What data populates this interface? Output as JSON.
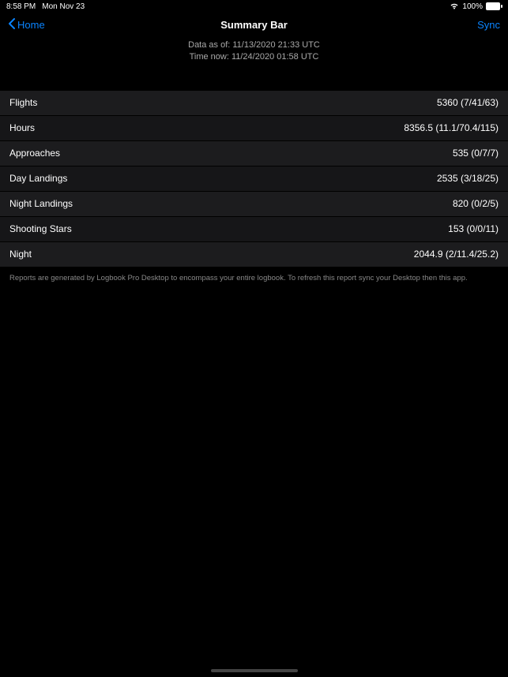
{
  "status": {
    "time": "8:58 PM",
    "date": "Mon Nov 23",
    "battery_pct": "100%"
  },
  "nav": {
    "back_label": "Home",
    "title": "Summary Bar",
    "sync_label": "Sync"
  },
  "header": {
    "data_as_of": "Data as of: 11/13/2020 21:33 UTC",
    "time_now": "Time now: 11/24/2020 01:58 UTC"
  },
  "rows": [
    {
      "label": "Flights",
      "value": "5360 (7/41/63)"
    },
    {
      "label": "Hours",
      "value": "8356.5 (11.1/70.4/115)"
    },
    {
      "label": "Approaches",
      "value": "535 (0/7/7)"
    },
    {
      "label": "Day Landings",
      "value": "2535 (3/18/25)"
    },
    {
      "label": "Night Landings",
      "value": "820 (0/2/5)"
    },
    {
      "label": "Shooting Stars",
      "value": "153 (0/0/11)"
    },
    {
      "label": "Night",
      "value": "2044.9 (2/11.4/25.2)"
    }
  ],
  "footer": {
    "note": "Reports are generated by Logbook Pro Desktop to encompass your entire logbook. To refresh this report sync your Desktop then this app."
  }
}
